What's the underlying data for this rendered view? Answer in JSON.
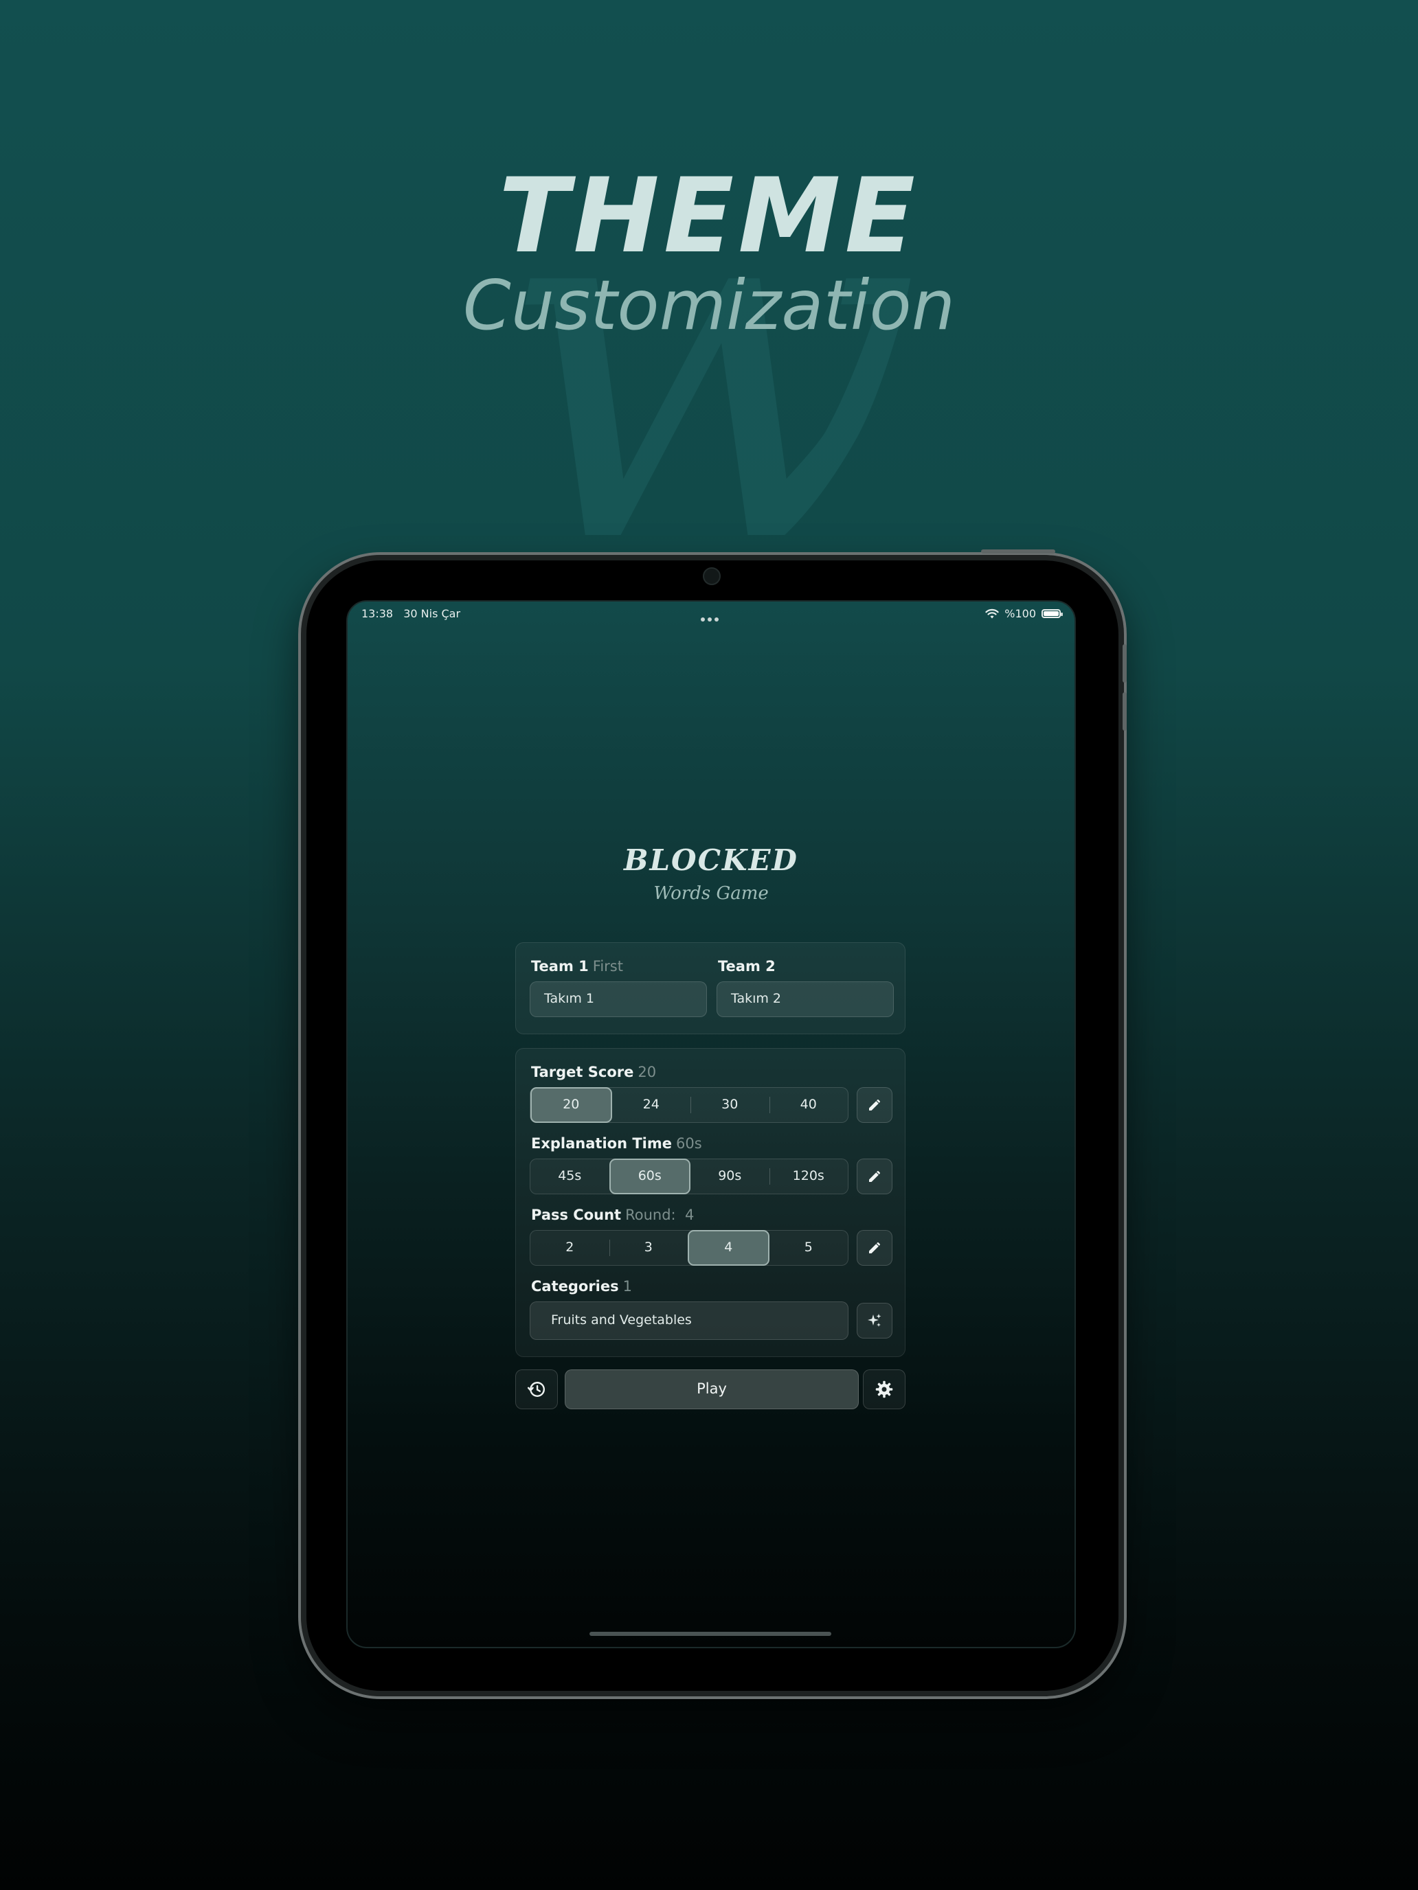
{
  "hero": {
    "title": "THEME",
    "subtitle": "Customization",
    "background_letter": "w"
  },
  "status_bar": {
    "time": "13:38",
    "date": "30 Nis Çar",
    "battery": "%100"
  },
  "app": {
    "title": "BLOCKED",
    "subtitle": "Words Game"
  },
  "teams": {
    "team1_label": "Team 1",
    "team1_hint": "First",
    "team1_value": "Takım 1",
    "team2_label": "Team 2",
    "team2_value": "Takım 2"
  },
  "settings": {
    "target_score": {
      "label": "Target Score",
      "current": "20",
      "options": [
        "20",
        "24",
        "30",
        "40"
      ],
      "selected_index": 0
    },
    "explanation_time": {
      "label": "Explanation Time",
      "current": "60s",
      "options": [
        "45s",
        "60s",
        "90s",
        "120s"
      ],
      "selected_index": 1
    },
    "pass_count": {
      "label": "Pass Count",
      "current": "Round:  4",
      "options": [
        "2",
        "3",
        "4",
        "5"
      ],
      "selected_index": 2
    },
    "categories": {
      "label": "Categories",
      "count": "1",
      "value": "Fruits and Vegetables"
    }
  },
  "actions": {
    "play_label": "Play"
  },
  "icons": {
    "edit": "pencil-icon",
    "sparkle": "sparkle-icon",
    "history": "history-icon",
    "settings": "gear-icon",
    "wifi": "wifi-icon",
    "battery": "battery-icon"
  },
  "colors": {
    "background_top": "#124f4f",
    "background_bottom": "#010303",
    "accent_selected": "#566c6a",
    "hero_title": "#cfe3e1",
    "hero_subtitle": "#8fb6b2"
  }
}
